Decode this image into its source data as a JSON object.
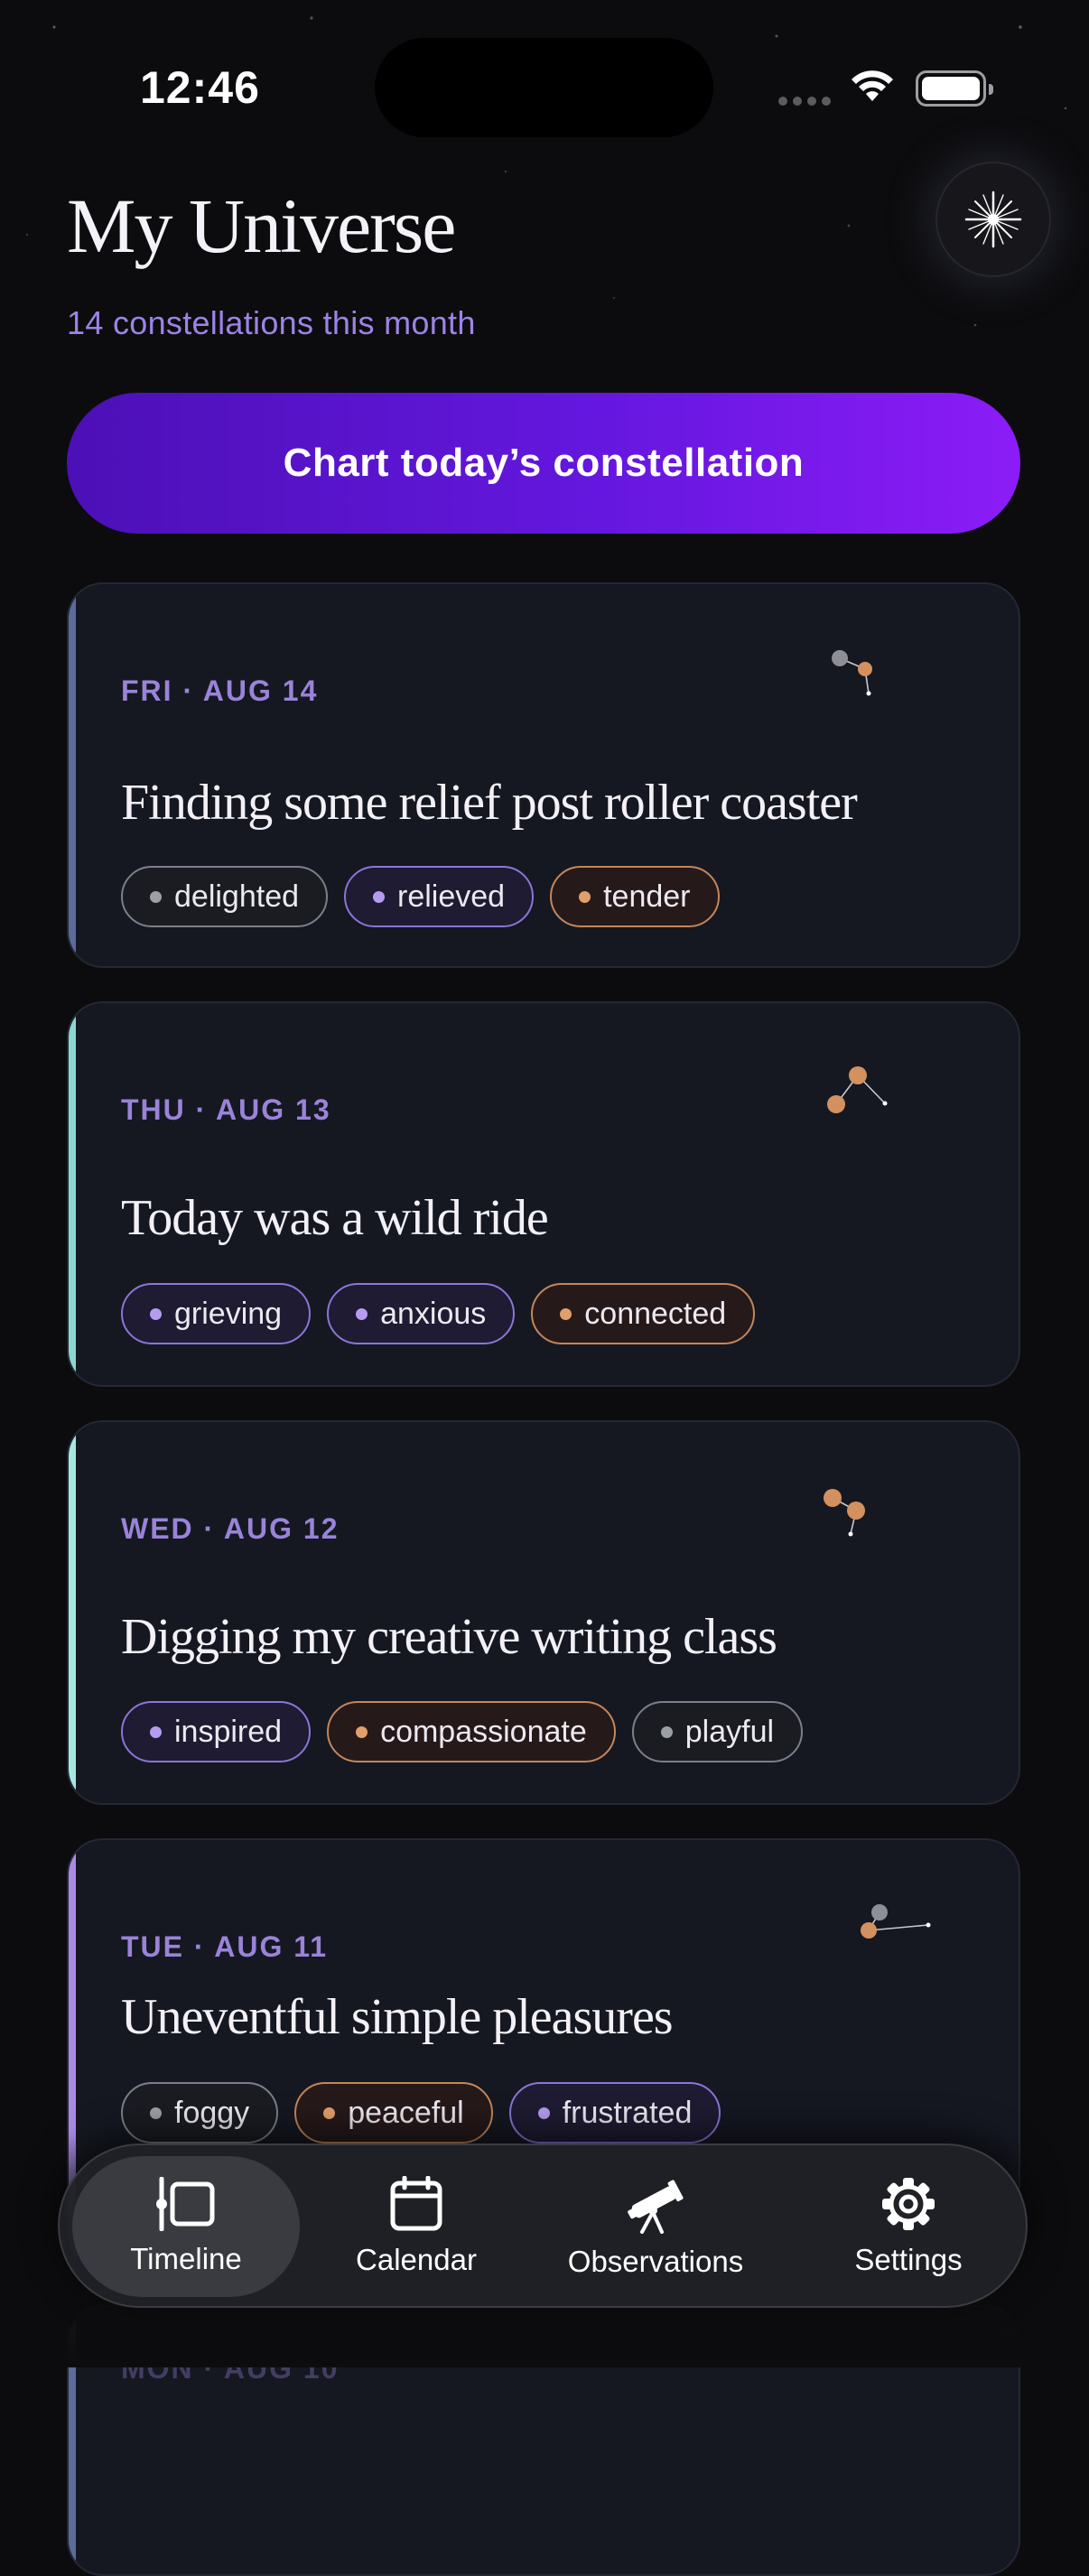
{
  "status_bar": {
    "time": "12:46"
  },
  "header": {
    "title": "My Universe",
    "subtitle": "14 constellations this month"
  },
  "cta": {
    "label": "Chart today’s constellation"
  },
  "entries": [
    {
      "date": "FRI · AUG 14",
      "title": "Finding some relief post roller coaster",
      "accent": "#5c6b9a",
      "tags": [
        {
          "label": "delighted",
          "tone": "gray"
        },
        {
          "label": "relieved",
          "tone": "purple"
        },
        {
          "label": "tender",
          "tone": "orange"
        }
      ]
    },
    {
      "date": "THU · AUG 13",
      "title": "Today was a wild ride",
      "accent": "#8ad7cf",
      "tags": [
        {
          "label": "grieving",
          "tone": "purple"
        },
        {
          "label": "anxious",
          "tone": "purple"
        },
        {
          "label": "connected",
          "tone": "orange"
        }
      ]
    },
    {
      "date": "WED · AUG 12",
      "title": "Digging my creative writing class",
      "accent": "#a6e8df",
      "tags": [
        {
          "label": "inspired",
          "tone": "purple"
        },
        {
          "label": "compassionate",
          "tone": "orange"
        },
        {
          "label": "playful",
          "tone": "gray"
        }
      ]
    },
    {
      "date": "TUE · AUG 11",
      "title": "Uneventful simple pleasures",
      "accent": "#a98be6",
      "tags": [
        {
          "label": "foggy",
          "tone": "gray"
        },
        {
          "label": "peaceful",
          "tone": "orange"
        },
        {
          "label": "frustrated",
          "tone": "purple"
        }
      ]
    },
    {
      "date": "MON · AUG 10",
      "title": "",
      "accent": "#5c6b9a",
      "tags": []
    }
  ],
  "nav": {
    "items": [
      {
        "label": "Timeline",
        "icon": "timeline-icon",
        "active": true
      },
      {
        "label": "Calendar",
        "icon": "calendar-icon",
        "active": false
      },
      {
        "label": "Observations",
        "icon": "telescope-icon",
        "active": false
      },
      {
        "label": "Settings",
        "icon": "gear-icon",
        "active": false
      }
    ]
  },
  "colors": {
    "background": "#0c0c0e",
    "accent_purple": "#6417de",
    "date_purple": "#9a83d9",
    "card": "#151821"
  }
}
